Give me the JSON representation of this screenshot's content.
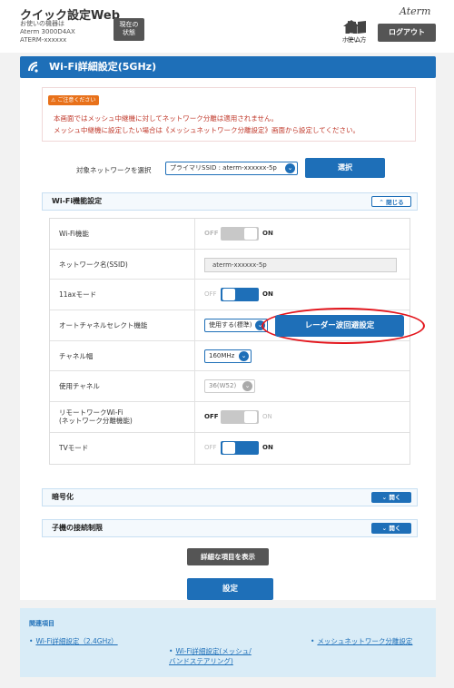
{
  "header": {
    "app_title": "クイック設定Web",
    "device_label": "お使いの機器は",
    "device_model": "Aterm 3000D4AX",
    "device_ssid": "ATERM-xxxxxx",
    "status_button": "現在の\n状態",
    "home_label": "ホーム",
    "help_label": "使い方",
    "logout_label": "ログアウト",
    "brand": "Aterm"
  },
  "page_title": "Wi-Fi詳細設定(5GHz)",
  "notice": {
    "badge": "ご注意ください",
    "line1": "本画面ではメッシュ中継機に対してネットワーク分離は適用されません。",
    "line2": "メッシュ中継機に設定したい場合は《メッシュネットワーク分離設定》画面から設定してください。"
  },
  "network_select": {
    "label": "対象ネットワークを選択",
    "value": "プライマリSSID : aterm-xxxxxx-5p",
    "button": "選択"
  },
  "wifi_section": {
    "title": "Wi-Fi機能設定",
    "toggle_label": "閉じる",
    "rows": [
      {
        "label": "Wi-Fi機能",
        "off": "OFF",
        "on": "ON"
      },
      {
        "label": "ネットワーク名(SSID)",
        "value": "aterm-xxxxxx-5p"
      },
      {
        "label": "11axモード",
        "off": "OFF",
        "on": "ON"
      },
      {
        "label": "オートチャネルセレクト機能",
        "value": "使用する(標準)",
        "button": "レーダー波回避設定"
      },
      {
        "label": "チャネル幅",
        "value": "160MHz"
      },
      {
        "label": "使用チャネル",
        "value": "36(W52)"
      },
      {
        "label": "リモートワークWi-Fi\n(ネットワーク分離機能)",
        "off": "OFF",
        "on": "ON"
      },
      {
        "label": "TVモード",
        "off": "OFF",
        "on": "ON"
      }
    ]
  },
  "encryption_section": {
    "title": "暗号化",
    "toggle_label": "開く"
  },
  "client_limit_section": {
    "title": "子機の接続制限",
    "toggle_label": "開く"
  },
  "buttons": {
    "show_details": "詳細な項目を表示",
    "apply": "設定"
  },
  "related": {
    "title": "関連項目",
    "links": [
      "Wi-Fi詳細設定（2.4GHz）",
      "Wi-Fi詳細設定(メッシュ/\nバンドステアリング)",
      "メッシュネットワーク分離設定"
    ]
  },
  "colors": {
    "accent": "#1e6fb8",
    "notice_text": "#c0392b",
    "highlight_ellipse": "#e3141b"
  }
}
